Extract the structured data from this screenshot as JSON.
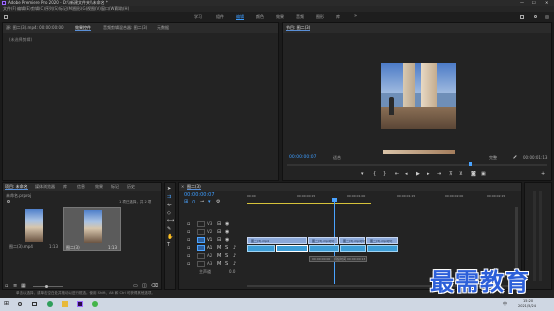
{
  "app": {
    "title": "Adobe Premiere Pro 2020 - D:\\\\新建文件夹\\\\未命名 *"
  },
  "menu": [
    "文件(F)",
    "编辑(E)",
    "剪辑(C)",
    "序列(S)",
    "标记(M)",
    "图形(G)",
    "视图(V)",
    "窗口(W)",
    "帮助(H)"
  ],
  "workspaces": [
    "学习",
    "组件",
    "编辑",
    "颜色",
    "效果",
    "音频",
    "图形",
    "库"
  ],
  "active_workspace": "编辑",
  "source_panel": {
    "tabs": [
      "源: 图二(3).mp4: 00:00:00:00",
      "效果控件",
      "音频剪辑混合器: 图二(3)",
      "元数据"
    ],
    "active_tab": "效果控件",
    "no_clip": "(未选择剪辑)"
  },
  "program_panel": {
    "title": "节目: 图二(3)",
    "timecode": "00:00:00:07",
    "fit": "适合",
    "quality": "完整",
    "duration": "00:00:01:13"
  },
  "project_panel": {
    "tabs": [
      "项目: 未命名",
      "媒体浏览器",
      "库",
      "信息",
      "效果",
      "标记",
      "历史"
    ],
    "active_tab": "项目: 未命名",
    "file": "未命名.prproj",
    "count": "1 项已选择，共 2 项",
    "items": [
      {
        "name": "图二(3).mp4",
        "duration": "1:13",
        "selected": false
      },
      {
        "name": "图二(3)",
        "duration": "1:13",
        "selected": true
      }
    ]
  },
  "timeline": {
    "tab": "图二(3)",
    "timecode": "00:00:00:07",
    "ruler": [
      "00:00",
      "00:00:00:15",
      "00:00:01:00",
      "00:00:01:15",
      "00:00:02:00",
      "00:00:02:15"
    ],
    "tracks": [
      "V3",
      "V2",
      "V1",
      "A1",
      "A2",
      "A3"
    ],
    "master": "主声道",
    "master_value": "0.0",
    "clips_video": [
      "图二(3).mp4",
      "图二(3).mp4[V]",
      "图二(3).mp4[V]",
      "图二(3).mp4[V]"
    ],
    "tooltip": [
      "00:00:00:00",
      "持续时间",
      "00:00:00:13"
    ]
  },
  "status_bar": {
    "hint": "单击以选择，或单击空白处并拖动以进行框选。使用 Shift、Alt 和 Ctrl 可获得其他选项。"
  },
  "taskbar": {
    "time": "15:20",
    "date": "2021/5/24",
    "lang": "中"
  },
  "watermark": "最需教育",
  "colors": {
    "accent": "#2d8ceb",
    "clip_video": "#8aa7d8",
    "clip_audio": "#3d9dd6",
    "playhead": "#4aa3ff"
  }
}
